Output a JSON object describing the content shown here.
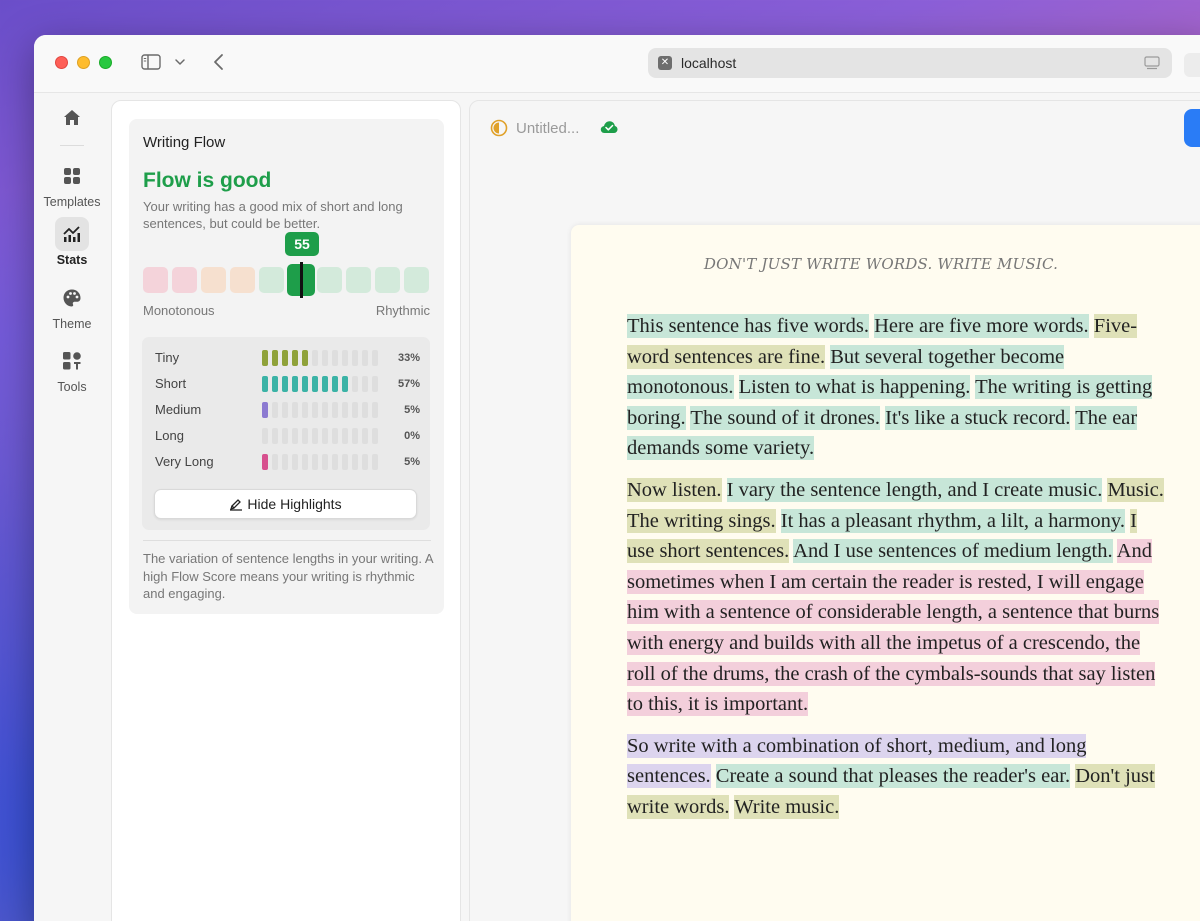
{
  "browser": {
    "url": "localhost"
  },
  "nav": {
    "items": [
      {
        "label": "Templates"
      },
      {
        "label": "Stats"
      },
      {
        "label": "Theme"
      },
      {
        "label": "Tools"
      }
    ]
  },
  "stats": {
    "title": "Writing Flow",
    "status": "Flow is good",
    "description": "Your writing has a good mix of short and long sentences, but could be better.",
    "score": "55",
    "scale_left": "Monotonous",
    "scale_right": "Rhythmic",
    "distribution": [
      {
        "name": "Tiny",
        "pct": "33%",
        "filled": 5,
        "color": "#8fa23a"
      },
      {
        "name": "Short",
        "pct": "57%",
        "filled": 9,
        "color": "#3bb3a6"
      },
      {
        "name": "Medium",
        "pct": "5%",
        "filled": 1,
        "color": "#8c7ad1"
      },
      {
        "name": "Long",
        "pct": "0%",
        "filled": 0,
        "color": "#cccccc"
      },
      {
        "name": "Very Long",
        "pct": "5%",
        "filled": 1,
        "color": "#d7508e"
      }
    ],
    "hide_button": "Hide Highlights",
    "footer": "The variation of sentence lengths in your writing. A high Flow Score means your writing is rhythmic and engaging."
  },
  "editor": {
    "doc_title": "Untitled...",
    "motto": "DON'T JUST WRITE WORDS. WRITE MUSIC.",
    "paragraphs": [
      [
        {
          "text": "This sentence has five words.",
          "cls": "short"
        },
        {
          "text": "Here are five more words.",
          "cls": "short"
        },
        {
          "text": "Five-word sentences are fine.",
          "cls": "tiny"
        },
        {
          "text": "But several together become monotonous.",
          "cls": "short"
        },
        {
          "text": "Listen to what is happening.",
          "cls": "short"
        },
        {
          "text": "The writing is getting boring.",
          "cls": "short"
        },
        {
          "text": "The sound of it drones.",
          "cls": "short"
        },
        {
          "text": "It's like a stuck record.",
          "cls": "short"
        },
        {
          "text": "The ear demands some variety.",
          "cls": "short"
        }
      ],
      [
        {
          "text": "Now listen.",
          "cls": "tiny"
        },
        {
          "text": "I vary the sentence length, and I create music.",
          "cls": "short"
        },
        {
          "text": "Music.",
          "cls": "tiny"
        },
        {
          "text": "The writing sings.",
          "cls": "tiny"
        },
        {
          "text": "It has a pleasant rhythm, a lilt, a harmony.",
          "cls": "short"
        },
        {
          "text": "I use short sentences.",
          "cls": "tiny"
        },
        {
          "text": "And I use sentences of medium length.",
          "cls": "short"
        },
        {
          "text": "And sometimes when I am certain the reader is rested, I will engage him with a sentence of considerable length, a sentence that burns with energy and builds with all the impetus of a crescendo, the roll of the drums, the crash of the cymbals-sounds that say listen to this, it is important.",
          "cls": "verylong"
        }
      ],
      [
        {
          "text": "So write with a combination of short, medium, and long sentences.",
          "cls": "medium"
        },
        {
          "text": "Create a sound that pleases the reader's ear.",
          "cls": "short"
        },
        {
          "text": "Don't just write words.",
          "cls": "tiny"
        },
        {
          "text": "Write music.",
          "cls": "tiny"
        }
      ]
    ]
  }
}
